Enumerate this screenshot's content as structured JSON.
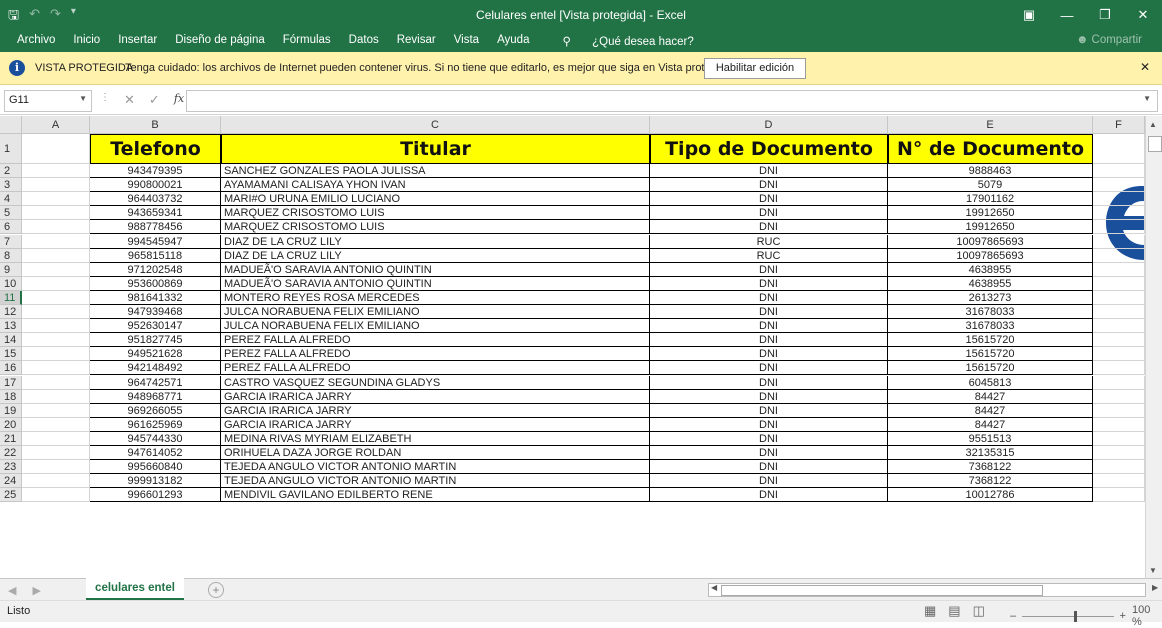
{
  "window": {
    "title": "Celulares entel  [Vista protegida]  -  Excel"
  },
  "ribbon": {
    "tabs": [
      "Archivo",
      "Inicio",
      "Insertar",
      "Diseño de página",
      "Fórmulas",
      "Datos",
      "Revisar",
      "Vista",
      "Ayuda"
    ],
    "tell_me": "¿Qué desea hacer?",
    "share": "Compartir"
  },
  "protected_view": {
    "label": "VISTA PROTEGIDA",
    "message": "Tenga cuidado: los archivos de Internet pueden contener virus. Si no tiene que editarlo, es mejor que siga en Vista protegida.",
    "button": "Habilitar edición"
  },
  "formula_bar": {
    "name_box": "G11",
    "fx": "fx",
    "value": ""
  },
  "columns": [
    "A",
    "B",
    "C",
    "D",
    "E",
    "F"
  ],
  "selected_row": "11",
  "headers": {
    "telefono": "Telefono",
    "titular": "Titular",
    "tipo": "Tipo de Documento",
    "numero": "N° de Documento"
  },
  "rows": [
    {
      "n": "2",
      "tel": "943479395",
      "tit": "SANCHEZ GONZALES PAOLA JULISSA",
      "tipo": "DNI",
      "num": "9888463"
    },
    {
      "n": "3",
      "tel": "990800021",
      "tit": "AYAMAMANI CALISAYA YHON  IVAN",
      "tipo": "DNI",
      "num": "5079"
    },
    {
      "n": "4",
      "tel": "964403732",
      "tit": "MARI#O URUNA EMILIO LUCIANO",
      "tipo": "DNI",
      "num": "17901162"
    },
    {
      "n": "5",
      "tel": "943659341",
      "tit": "MARQUEZ CRISOSTOMO LUIS",
      "tipo": "DNI",
      "num": "19912650"
    },
    {
      "n": "6",
      "tel": "988778456",
      "tit": "MARQUEZ CRISOSTOMO LUIS",
      "tipo": "DNI",
      "num": "19912650"
    },
    {
      "n": "7",
      "tel": "994545947",
      "tit": "DIAZ DE LA CRUZ LILY",
      "tipo": "RUC",
      "num": "10097865693"
    },
    {
      "n": "8",
      "tel": "965815118",
      "tit": "DIAZ DE LA CRUZ LILY",
      "tipo": "RUC",
      "num": "10097865693"
    },
    {
      "n": "9",
      "tel": "971202548",
      "tit": "MADUEÃ'O SARAVIA ANTONIO QUINTIN",
      "tipo": "DNI",
      "num": "4638955"
    },
    {
      "n": "10",
      "tel": "953600869",
      "tit": "MADUEÃ'O SARAVIA ANTONIO QUINTIN",
      "tipo": "DNI",
      "num": "4638955"
    },
    {
      "n": "11",
      "tel": "981641332",
      "tit": "MONTERO REYES ROSA MERCEDES",
      "tipo": "DNI",
      "num": "2613273"
    },
    {
      "n": "12",
      "tel": "947939468",
      "tit": "JULCA NORABUENA FELIX EMILIANO",
      "tipo": "DNI",
      "num": "31678033"
    },
    {
      "n": "13",
      "tel": "952630147",
      "tit": "JULCA NORABUENA FELIX EMILIANO",
      "tipo": "DNI",
      "num": "31678033"
    },
    {
      "n": "14",
      "tel": "951827745",
      "tit": "PEREZ FALLA ALFREDO",
      "tipo": "DNI",
      "num": "15615720"
    },
    {
      "n": "15",
      "tel": "949521628",
      "tit": "PEREZ FALLA ALFREDO",
      "tipo": "DNI",
      "num": "15615720"
    },
    {
      "n": "16",
      "tel": "942148492",
      "tit": "PEREZ FALLA ALFREDO",
      "tipo": "DNI",
      "num": "15615720"
    },
    {
      "n": "17",
      "tel": "964742571",
      "tit": "CASTRO VASQUEZ SEGUNDINA GLADYS",
      "tipo": "DNI",
      "num": "6045813"
    },
    {
      "n": "18",
      "tel": "948968771",
      "tit": "GARCIA IRARICA JARRY",
      "tipo": "DNI",
      "num": "84427"
    },
    {
      "n": "19",
      "tel": "969266055",
      "tit": "GARCIA IRARICA JARRY",
      "tipo": "DNI",
      "num": "84427"
    },
    {
      "n": "20",
      "tel": "961625969",
      "tit": "GARCIA IRARICA JARRY",
      "tipo": "DNI",
      "num": "84427"
    },
    {
      "n": "21",
      "tel": "945744330",
      "tit": "MEDINA RIVAS MYRIAM ELIZABETH",
      "tipo": "DNI",
      "num": "9551513"
    },
    {
      "n": "22",
      "tel": "947614052",
      "tit": "ORIHUELA DAZA JORGE ROLDAN",
      "tipo": "DNI",
      "num": "32135315"
    },
    {
      "n": "23",
      "tel": "995660840",
      "tit": "TEJEDA ANGULO VICTOR  ANTONIO MARTIN",
      "tipo": "DNI",
      "num": "7368122"
    },
    {
      "n": "24",
      "tel": "999913182",
      "tit": "TEJEDA ANGULO VICTOR  ANTONIO MARTIN",
      "tipo": "DNI",
      "num": "7368122"
    },
    {
      "n": "25",
      "tel": "996601293",
      "tit": "MENDIVIL GAVILANO EDILBERTO RENE",
      "tipo": "DNI",
      "num": "10012786"
    }
  ],
  "sheet_tab": "celulares entel",
  "status": {
    "text": "Listo",
    "zoom": "100 %"
  },
  "colors": {
    "excel_green": "#217346",
    "header_fill": "#ffff00",
    "protected_bar": "#fff2ac",
    "logo_blue": "#1a4f9c"
  }
}
